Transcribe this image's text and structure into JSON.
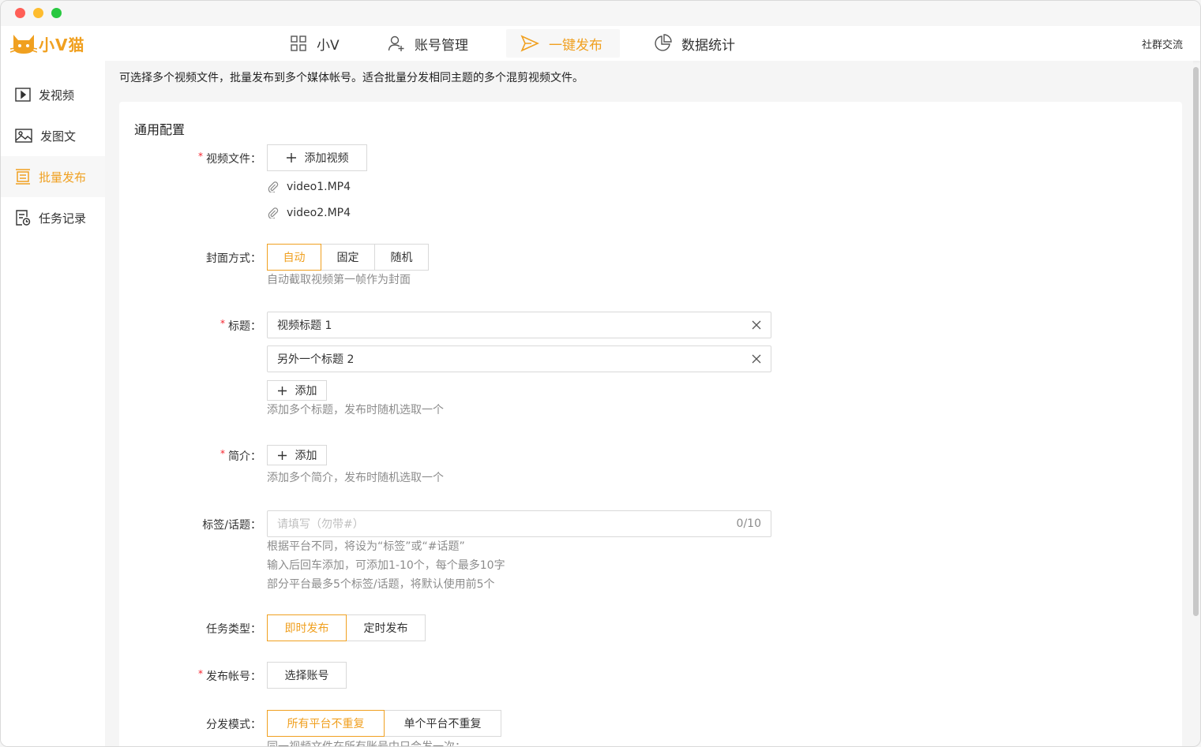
{
  "app": {
    "logo_text": "小V猫"
  },
  "topnav": {
    "items": [
      {
        "label": "小V",
        "icon": "grid-icon"
      },
      {
        "label": "账号管理",
        "icon": "user-add-icon"
      },
      {
        "label": "一键发布",
        "icon": "send-icon",
        "active": true
      },
      {
        "label": "数据统计",
        "icon": "pie-chart-icon"
      }
    ],
    "community": "社群交流"
  },
  "sidebar": {
    "items": [
      {
        "label": "发视频",
        "icon": "video-icon"
      },
      {
        "label": "发图文",
        "icon": "image-icon"
      },
      {
        "label": "批量发布",
        "icon": "batch-icon",
        "active": true
      },
      {
        "label": "任务记录",
        "icon": "task-record-icon"
      }
    ]
  },
  "main": {
    "intro": "可选择多个视频文件，批量发布到多个媒体帐号。适合批量分发相同主题的多个混剪视频文件。",
    "section_title": "通用配置",
    "video_files": {
      "label": "视频文件：",
      "add_button": "添加视频",
      "files": [
        "video1.MP4",
        "video2.MP4"
      ]
    },
    "cover": {
      "label": "封面方式：",
      "options": [
        "自动",
        "固定",
        "随机"
      ],
      "selected": "自动",
      "hint": "自动截取视频第一帧作为封面"
    },
    "title": {
      "label": "标题：",
      "values": [
        "视频标题  1",
        "另外一个标题  2"
      ],
      "add_button": "添加",
      "hint": "添加多个标题，发布时随机选取一个"
    },
    "intro_field": {
      "label": "简介：",
      "add_button": "添加",
      "hint": "添加多个简介，发布时随机选取一个"
    },
    "tags": {
      "label": "标签/话题：",
      "placeholder": "请填写（勿带#）",
      "count": "0/10",
      "hints": [
        "根据平台不同，将设为“标签”或“#话题”",
        "输入后回车添加，可添加1-10个，每个最多10字",
        "部分平台最多5个标签/话题，将默认使用前5个"
      ]
    },
    "task_type": {
      "label": "任务类型：",
      "options": [
        "即时发布",
        "定时发布"
      ],
      "selected": "即时发布"
    },
    "account": {
      "label": "发布帐号：",
      "button": "选择账号"
    },
    "distribution": {
      "label": "分发模式：",
      "options": [
        "所有平台不重复",
        "单个平台不重复"
      ],
      "selected": "所有平台不重复",
      "hint": "同一视频文件在所有账号中只会发一次；"
    }
  },
  "colors": {
    "accent": "#f0a020",
    "required": "#f5222d"
  }
}
